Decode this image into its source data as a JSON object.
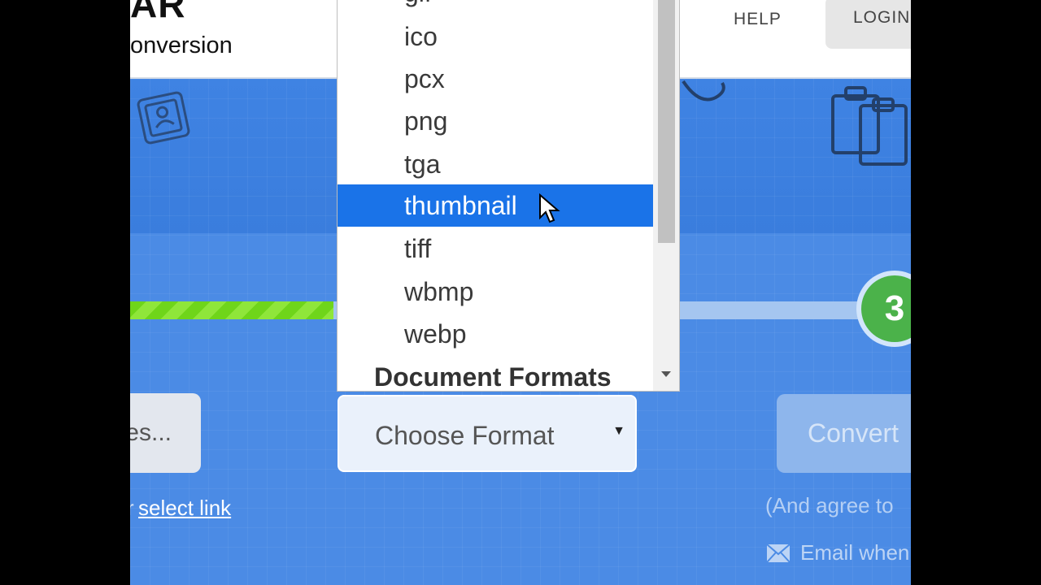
{
  "header": {
    "logo_main": "AR",
    "logo_sub": "onversion",
    "nav_help": "HELP",
    "nav_login": "LOGIN"
  },
  "progress": {
    "step_number": "3",
    "fill_fraction": 0.26
  },
  "actions": {
    "choose_files_label": "es...",
    "select_link_prefix": "r",
    "select_link_label": "select link",
    "choose_format_label": "Choose Format",
    "convert_label": "Convert",
    "agree_text": "(And agree to",
    "email_text": "Email when"
  },
  "dropdown": {
    "options": [
      {
        "label": "gif",
        "selected": false
      },
      {
        "label": "ico",
        "selected": false
      },
      {
        "label": "pcx",
        "selected": false
      },
      {
        "label": "png",
        "selected": false
      },
      {
        "label": "tga",
        "selected": false
      },
      {
        "label": "thumbnail",
        "selected": true
      },
      {
        "label": "tiff",
        "selected": false
      },
      {
        "label": "wbmp",
        "selected": false
      },
      {
        "label": "webp",
        "selected": false
      }
    ],
    "group_label": "Document Formats",
    "selected_color": "#1a73e8"
  },
  "icons": {
    "decoration_left": "id-badge-icon",
    "decoration_right": "clipboard-icon",
    "email": "envelope-icon",
    "cursor": "mouse-pointer-icon"
  }
}
